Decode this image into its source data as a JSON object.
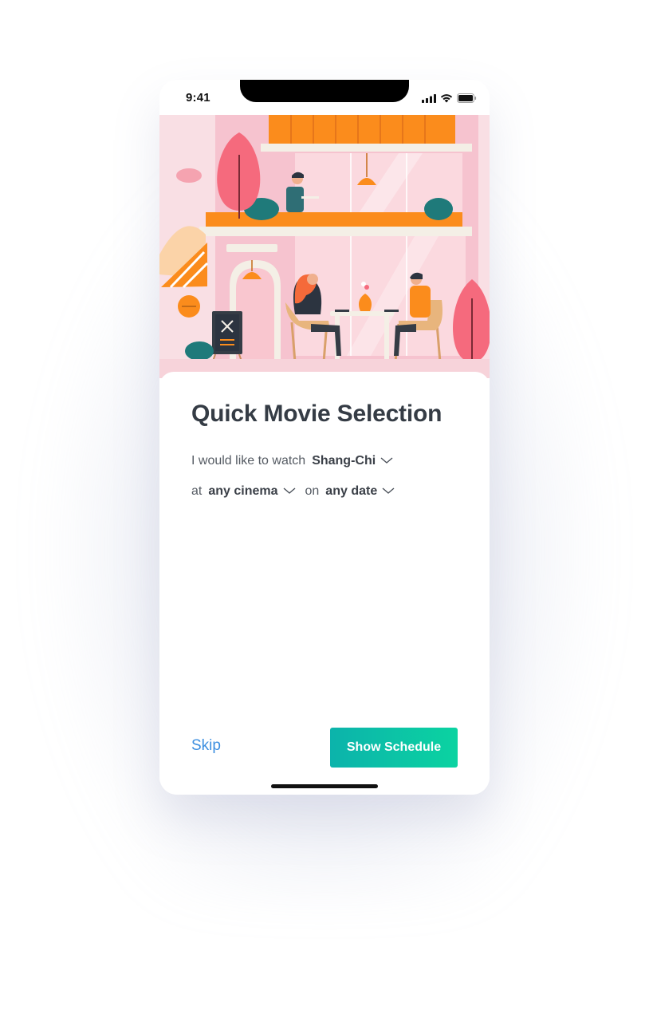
{
  "status_bar": {
    "time": "9:41",
    "icons": [
      "cellular-signal-icon",
      "wifi-icon",
      "battery-icon"
    ]
  },
  "hero": {
    "illustration": "cafe-terrace-illustration"
  },
  "content": {
    "title": "Quick Movie Selection",
    "sentence": {
      "prefix": "I would like to watch",
      "movie": "Shang-Chi",
      "at_label": "at",
      "cinema": "any cinema",
      "on_label": "on",
      "date": "any date"
    }
  },
  "actions": {
    "skip_label": "Skip",
    "primary_label": "Show Schedule"
  },
  "colors": {
    "accent_gradient_start": "#0cb3ab",
    "accent_gradient_end": "#0bd3a1",
    "link": "#3d8fe0",
    "title": "#353c45"
  }
}
